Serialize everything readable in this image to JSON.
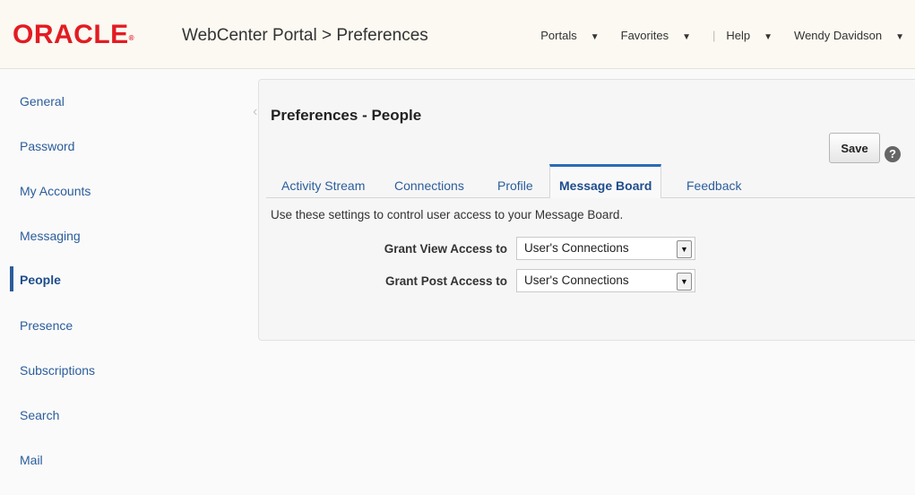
{
  "header": {
    "logo": "ORACLE",
    "app_title": "WebCenter Portal > Preferences",
    "nav": [
      {
        "label": "Portals"
      },
      {
        "label": "Favorites"
      },
      {
        "label": "Help"
      },
      {
        "label": "Wendy Davidson"
      }
    ]
  },
  "sidebar": {
    "items": [
      {
        "label": "General"
      },
      {
        "label": "Password"
      },
      {
        "label": "My Accounts"
      },
      {
        "label": "Messaging"
      },
      {
        "label": "People"
      },
      {
        "label": "Presence"
      },
      {
        "label": "Subscriptions"
      },
      {
        "label": "Search"
      },
      {
        "label": "Mail"
      }
    ],
    "active": "People"
  },
  "main": {
    "title": "Preferences - People",
    "save_label": "Save",
    "help_glyph": "?",
    "tabs": [
      {
        "label": "Activity Stream"
      },
      {
        "label": "Connections"
      },
      {
        "label": "Profile"
      },
      {
        "label": "Message Board"
      },
      {
        "label": "Feedback"
      }
    ],
    "active_tab": "Message Board",
    "instruction": "Use these settings to control user access to your Message Board.",
    "fields": {
      "view": {
        "label": "Grant View Access to",
        "value": "User's Connections"
      },
      "post": {
        "label": "Grant Post Access to",
        "value": "User's Connections"
      }
    }
  },
  "colors": {
    "brand": "#e31b23",
    "link": "#2b5d9b",
    "active_tab_border": "#2b6ab5"
  }
}
